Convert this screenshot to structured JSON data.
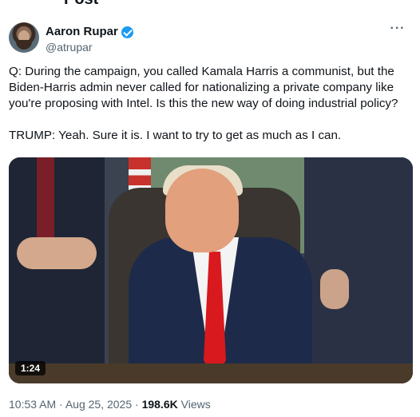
{
  "header": {
    "title": "Post"
  },
  "author": {
    "name": "Aaron Rupar",
    "handle": "@atrupar",
    "verified": true
  },
  "more_menu": {
    "icon": "more-horizontal-icon",
    "glyph": "···"
  },
  "tweet": {
    "text": "Q: During the campaign, you called Kamala Harris a communist, but the Biden-Harris admin never called for nationalizing a private company like you're proposing with Intel. Is this the new way of doing industrial policy?\n\nTRUMP: Yeah. Sure it is. I want to try to get as much as I can."
  },
  "media": {
    "type": "video",
    "duration": "1:24"
  },
  "meta": {
    "time": "10:53 AM",
    "separator": " · ",
    "date": "Aug 25, 2025",
    "views_count": "198.6K",
    "views_label": " Views"
  },
  "colors": {
    "accent": "#1d9bf0",
    "secondary_text": "#536471",
    "primary_text": "#0f1419"
  }
}
